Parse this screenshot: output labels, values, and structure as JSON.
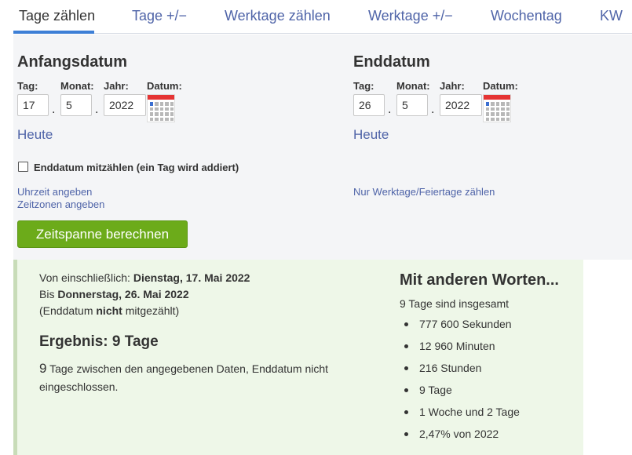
{
  "tabs": [
    {
      "label": "Tage zählen",
      "active": true
    },
    {
      "label": "Tage +/−",
      "active": false
    },
    {
      "label": "Werktage zählen",
      "active": false
    },
    {
      "label": "Werktage +/−",
      "active": false
    },
    {
      "label": "Wochentag",
      "active": false
    },
    {
      "label": "KW",
      "active": false
    }
  ],
  "start": {
    "title": "Anfangsdatum",
    "day_label": "Tag:",
    "month_label": "Monat:",
    "year_label": "Jahr:",
    "date_label": "Datum:",
    "day": "17",
    "month": "5",
    "year": "2022",
    "today_link": "Heute"
  },
  "end": {
    "title": "Enddatum",
    "day_label": "Tag:",
    "month_label": "Monat:",
    "year_label": "Jahr:",
    "date_label": "Datum:",
    "day": "26",
    "month": "5",
    "year": "2022",
    "today_link": "Heute"
  },
  "separator": ".",
  "include_end_date": {
    "label": "Enddatum mitzählen (ein Tag wird addiert)",
    "checked": false
  },
  "links": {
    "time": "Uhrzeit angeben",
    "timezones": "Zeitzonen angeben",
    "workdays": "Nur Werktage/Feiertage zählen"
  },
  "calculate_button": "Zeitspanne berechnen",
  "result": {
    "from_prefix": "Von einschließlich: ",
    "from_date": "Dienstag, 17. Mai 2022",
    "to_prefix": "Bis ",
    "to_date": "Donnerstag, 26. Mai 2022",
    "note_open": "(Enddatum ",
    "note_bold": "nicht",
    "note_close": " mitgezählt)",
    "heading": "Ergebnis: 9 Tage",
    "count": "9",
    "description": " Tage zwischen den angegebenen Daten, Enddatum nicht eingeschlossen."
  },
  "other_words": {
    "title": "Mit anderen Worten...",
    "summary": "9 Tage sind insgesamt",
    "items": [
      "777 600 Sekunden",
      "12 960 Minuten",
      "216 Stunden",
      "9 Tage",
      "1 Woche und 2 Tage",
      "2,47% von 2022"
    ]
  },
  "colors": {
    "link": "#4f64a8",
    "active_tab_underline": "#3d7fd6",
    "button": "#6cab1a",
    "result_background": "#eef7e8",
    "calendar_header": "#e53434"
  },
  "icons": {
    "calendar": "calendar-icon",
    "checkbox": "checkbox-unchecked"
  }
}
